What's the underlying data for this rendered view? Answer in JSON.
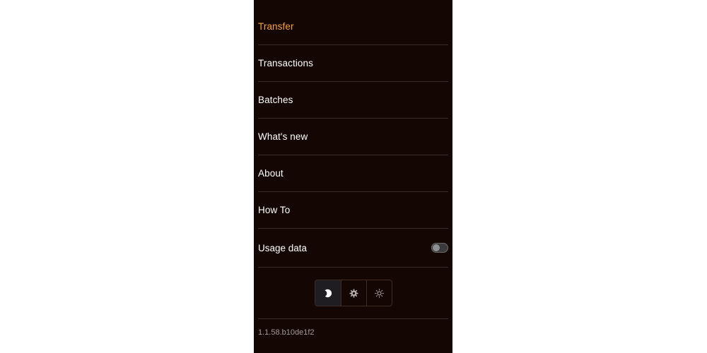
{
  "menu": {
    "items": [
      {
        "label": "Transfer",
        "active": true
      },
      {
        "label": "Transactions"
      },
      {
        "label": "Batches"
      },
      {
        "label": "What's new"
      },
      {
        "label": "About"
      },
      {
        "label": "How To"
      }
    ],
    "usage_data": {
      "label": "Usage data",
      "enabled": false
    }
  },
  "theme_switcher": {
    "options": [
      {
        "icon": "moon-icon",
        "selected": true
      },
      {
        "icon": "gear-icon",
        "selected": false
      },
      {
        "icon": "sun-icon",
        "selected": false
      }
    ]
  },
  "version": "1.1.58.b10de1f2",
  "colors": {
    "background": "#140703",
    "accent": "#f7a23a",
    "divider": "#3a2b26",
    "text": "#ffffff",
    "muted": "#a39a96"
  }
}
